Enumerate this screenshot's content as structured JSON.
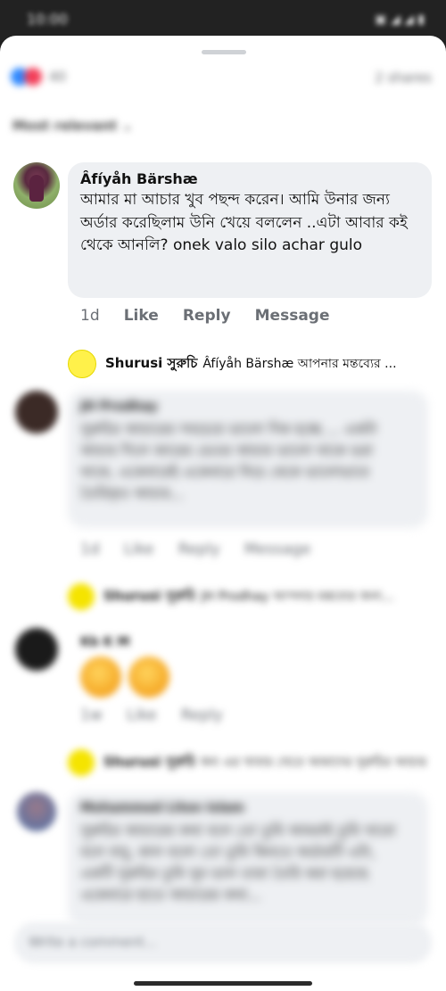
{
  "status_bar": {
    "time": "10:00"
  },
  "header": {
    "reaction_count": "40",
    "shares": "2 shares"
  },
  "sort": {
    "label": "Most relevant"
  },
  "comments": [
    {
      "author": "Âfíyåh Bärshæ",
      "text": "আমার মা আচার খুব পছন্দ করেন। আমি উনার জন্য অর্ডার করেছিলাম উনি খেয়ে বললেন ..এটা আবার কই থেকে আনলি? onek valo silo achar gulo",
      "time": "1d",
      "like": "Like",
      "reply": "Reply",
      "message": "Message",
      "reply_preview": {
        "author": "Shurusi সুরুচি",
        "text": "Âfíyåh Bärshæ আপনার মন্তব্যের ..."
      }
    },
    {
      "author": "JH Prodhay",
      "text": "সুরুচির আচারের সবচেয়ে ভালো দিক হচ্ছে ... একটা আচার দিলে জারের ভেতর আচার ভালো থাকে ভরা থাকে, একেবারেই একেবারে নিচে থেকে ভালোভাবে তৈরিকৃত আচার...",
      "time": "1d",
      "like": "Like",
      "reply": "Reply",
      "message": "Message",
      "reply_preview": {
        "author": "Shurusi সুরুচি",
        "text": "JH Prodhay আপনার মন্তব্যের জন্য..."
      }
    },
    {
      "author": "Kb K M",
      "time": "1w",
      "like": "Like",
      "reply": "Reply",
      "reply_preview": {
        "author": "Shurusi সুরুচি",
        "text": "ধন্য এর খাবার খেতে আমাদের সুরুচির আচার"
      }
    },
    {
      "author": "Mohammed Liton Islam",
      "text": "সুরুচির আচারের কথা বলে তো তুমি আমরাই তুমি খাবো বলে বাবু, কাল বলো তো তুমি কিনতে অর্ডারটি এটা, একটি সুরুচির তুমি খুব ভাল তারা তৈরি করা হয়েছে একেবারে হাতে আচারের কথা..."
    }
  ],
  "composer": {
    "placeholder": "Write a comment..."
  },
  "colors": {
    "sheet_bg": "#ffffff",
    "bubble_bg": "#eef0f3",
    "meta_text": "#6b6f75"
  }
}
